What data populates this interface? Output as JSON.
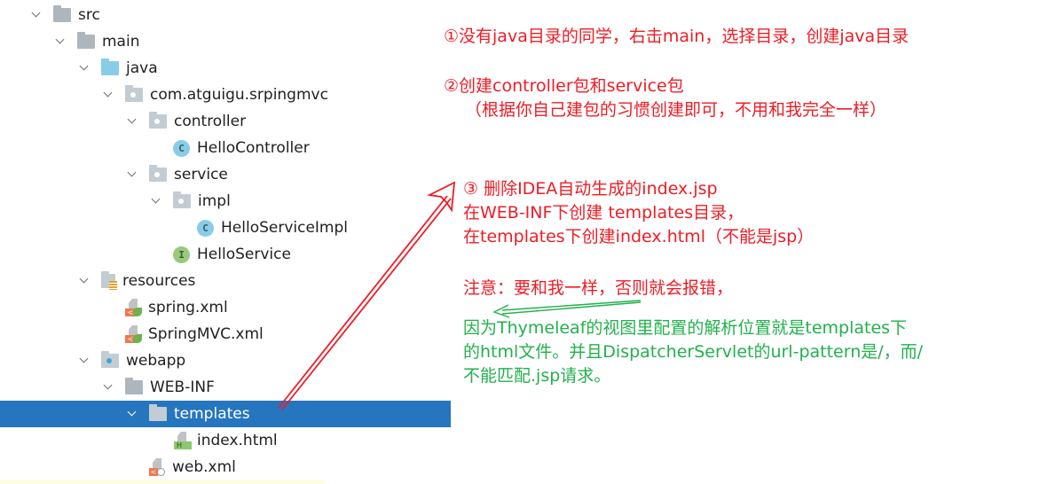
{
  "tree": {
    "items": [
      {
        "label": "src",
        "icon": "folder-icon",
        "expanded": true
      },
      {
        "label": "main",
        "icon": "folder-icon",
        "expanded": true
      },
      {
        "label": "java",
        "icon": "source-root-folder-icon",
        "expanded": true
      },
      {
        "label": "com.atguigu.srpingmvc",
        "icon": "package-icon",
        "expanded": true
      },
      {
        "label": "controller",
        "icon": "package-icon",
        "expanded": true
      },
      {
        "label": "HelloController",
        "icon": "class-icon",
        "glyph": "C"
      },
      {
        "label": "service",
        "icon": "package-icon",
        "expanded": true
      },
      {
        "label": "impl",
        "icon": "package-icon",
        "expanded": true
      },
      {
        "label": "HelloServiceImpl",
        "icon": "class-icon",
        "glyph": "C"
      },
      {
        "label": "HelloService",
        "icon": "interface-icon",
        "glyph": "I"
      },
      {
        "label": "resources",
        "icon": "resources-folder-icon",
        "expanded": true
      },
      {
        "label": "spring.xml",
        "icon": "spring-xml-icon"
      },
      {
        "label": "SpringMVC.xml",
        "icon": "spring-xml-icon"
      },
      {
        "label": "webapp",
        "icon": "web-folder-icon",
        "expanded": true
      },
      {
        "label": "WEB-INF",
        "icon": "folder-icon",
        "expanded": true
      },
      {
        "label": "templates",
        "icon": "folder-icon",
        "expanded": true,
        "selected": true
      },
      {
        "label": "index.html",
        "icon": "html-file-icon",
        "badge": "H"
      },
      {
        "label": "web.xml",
        "icon": "web-xml-icon"
      }
    ],
    "selected_color": "#2675bf"
  },
  "annotations": {
    "note1": "①没有java目录的同学，右击main，选择目录，创建java目录",
    "note2_line1": "②创建controller包和service包",
    "note2_line2": "（根据你自己建包的习惯创建即可，不用和我完全一样）",
    "note3_line1": "③ 删除IDEA自动生成的index.jsp",
    "note3_line2": "在WEB-INF下创建 templates目录，",
    "note3_line3": "在templates下创建index.html（不能是jsp）",
    "warning": "注意：要和我一样，否则就会报错，",
    "reason_line1": "因为Thymeleaf的视图里配置的解析位置就是templates下",
    "reason_line2": "的html文件。并且DispatcherServlet的url-pattern是/，而/",
    "reason_line3": "不能匹配.jsp请求。",
    "red_color": "#ee1c25",
    "green_color": "#22b14c"
  }
}
